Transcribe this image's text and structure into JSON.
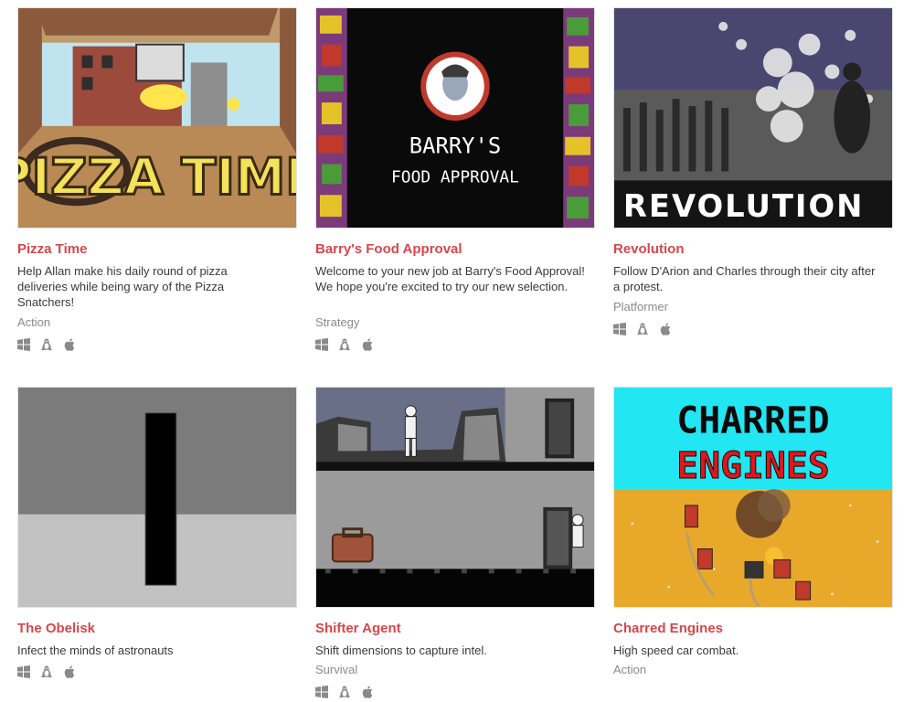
{
  "games": [
    {
      "title": "Pizza Time",
      "description": "Help Allan make his daily round of pizza deliveries while being wary of the Pizza Snatchers!",
      "genre": "Action",
      "thumb_text": "PIZZA TIME",
      "platforms": [
        "windows-icon",
        "linux-icon",
        "apple-icon"
      ]
    },
    {
      "title": "Barry's Food Approval",
      "description": "Welcome to your new job at Barry's Food Approval! We hope you're excited to try our new selection.",
      "genre": "Strategy",
      "thumb_text_1": "BARRY'S",
      "thumb_text_2": "FOOD APPROVAL",
      "platforms": [
        "windows-icon",
        "linux-icon",
        "apple-icon"
      ]
    },
    {
      "title": "Revolution",
      "description": "Follow D'Arion and Charles through their city after a protest.",
      "genre": "Platformer",
      "thumb_text": "REVOLUTION",
      "platforms": [
        "windows-icon",
        "linux-icon",
        "apple-icon"
      ]
    },
    {
      "title": "The Obelisk",
      "description": "Infect the minds of astronauts",
      "genre": "",
      "platforms": [
        "windows-icon",
        "linux-icon",
        "apple-icon"
      ]
    },
    {
      "title": "Shifter Agent",
      "description": "Shift dimensions to capture intel.",
      "genre": "Survival",
      "platforms": [
        "windows-icon",
        "linux-icon",
        "apple-icon"
      ]
    },
    {
      "title": "Charred Engines",
      "description": "High speed car combat.",
      "genre": "Action",
      "thumb_text_1": "CHARRED",
      "thumb_text_2": "ENGINES",
      "platforms": []
    }
  ],
  "colors": {
    "title": "#d9464a",
    "description": "#3a3a3a",
    "genre": "#8a8a8a",
    "platform_icon": "#8a8a8a"
  }
}
